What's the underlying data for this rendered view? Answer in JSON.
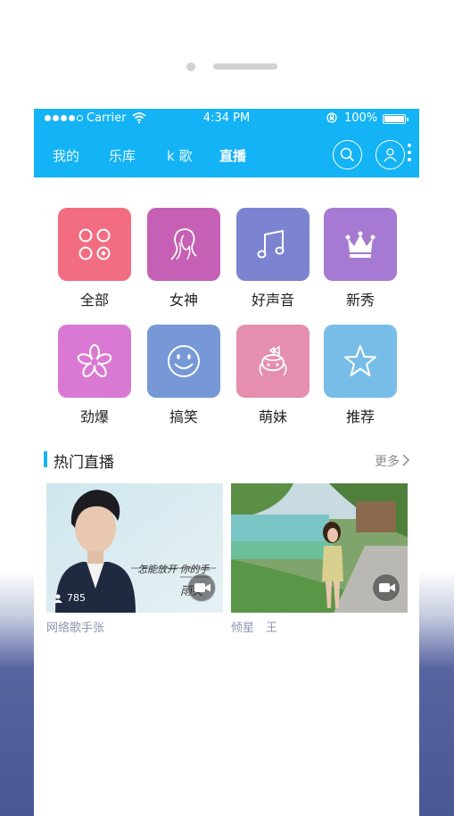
{
  "status_bar": {
    "carrier": "Carrier",
    "time": "4:34 PM",
    "battery": "100%"
  },
  "tabs": [
    {
      "label": "我的",
      "active": false
    },
    {
      "label": "乐库",
      "active": false
    },
    {
      "label": "k 歌",
      "active": false
    },
    {
      "label": "直播",
      "active": true
    }
  ],
  "header_icons": [
    "search-icon",
    "user-icon",
    "more-icon"
  ],
  "categories": [
    {
      "label": "全部",
      "icon": "grid-icon",
      "color": "#f26d82"
    },
    {
      "label": "女神",
      "icon": "goddess-icon",
      "color": "#c660b4"
    },
    {
      "label": "好声音",
      "icon": "music-note-icon",
      "color": "#7c84d2"
    },
    {
      "label": "新秀",
      "icon": "crown-icon",
      "color": "#a67ad2"
    },
    {
      "label": "劲爆",
      "icon": "flower-icon",
      "color": "#d979d3"
    },
    {
      "label": "搞笑",
      "icon": "smiley-icon",
      "color": "#7698d6"
    },
    {
      "label": "萌妹",
      "icon": "cute-girl-icon",
      "color": "#e58eaf"
    },
    {
      "label": "推荐",
      "icon": "star-icon",
      "color": "#78bde8"
    }
  ],
  "section": {
    "title": "热门直播",
    "more": "更多"
  },
  "streams": [
    {
      "name": "网络歌手张",
      "views": "785",
      "overlay_text": "怎能放开 你的手",
      "overlay_text_2": "雨笑"
    },
    {
      "name": "倾星　王"
    }
  ],
  "colors": {
    "accent": "#13b3f6"
  }
}
